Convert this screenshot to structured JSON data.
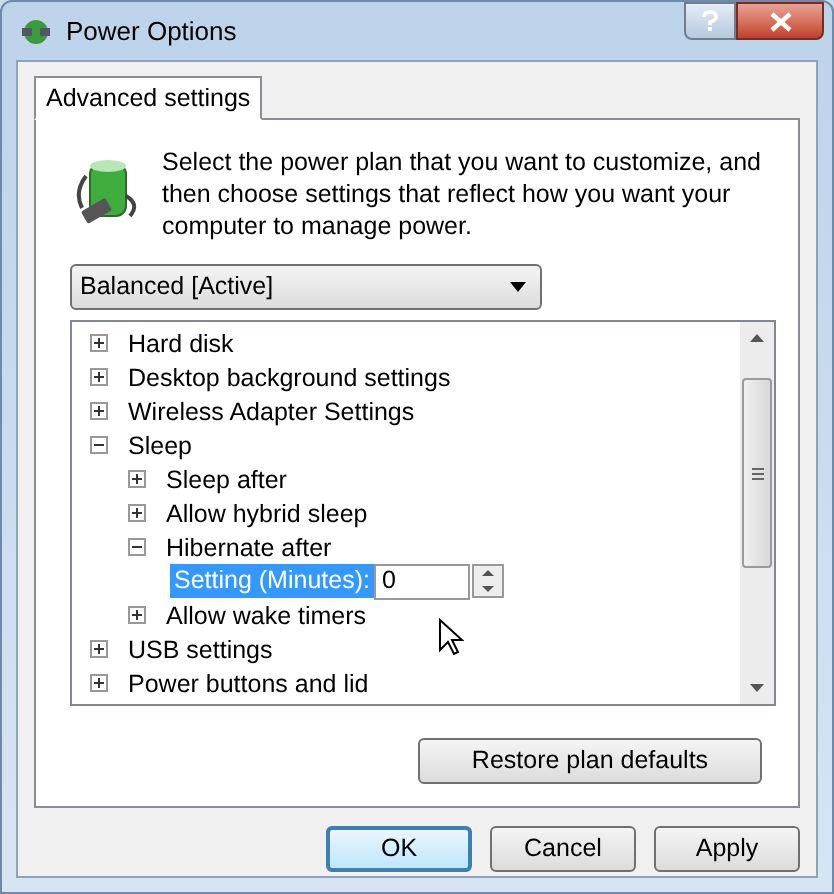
{
  "window": {
    "title": "Power Options"
  },
  "tabs": [
    {
      "label": "Advanced settings",
      "selected": true
    }
  ],
  "description": "Select the power plan that you want to customize, and then choose settings that reflect how you want your computer to manage power.",
  "plan_dropdown": {
    "value": "Balanced [Active]"
  },
  "tree": [
    {
      "label": "Hard disk",
      "expanded": false
    },
    {
      "label": "Desktop background settings",
      "expanded": false
    },
    {
      "label": "Wireless Adapter Settings",
      "expanded": false
    },
    {
      "label": "Sleep",
      "expanded": true,
      "children": [
        {
          "label": "Sleep after",
          "expanded": false
        },
        {
          "label": "Allow hybrid sleep",
          "expanded": false
        },
        {
          "label": "Hibernate after",
          "expanded": true,
          "children": [
            {
              "kind": "setting",
              "label": "Setting (Minutes):",
              "value": "0",
              "selected": true
            }
          ]
        },
        {
          "label": "Allow wake timers",
          "expanded": false
        }
      ]
    },
    {
      "label": "USB settings",
      "expanded": false
    },
    {
      "label": "Power buttons and lid",
      "expanded": false
    }
  ],
  "restore_button": "Restore plan defaults",
  "buttons": [
    {
      "label": "OK",
      "default": true
    },
    {
      "label": "Cancel",
      "default": false
    },
    {
      "label": "Apply",
      "default": false
    }
  ]
}
